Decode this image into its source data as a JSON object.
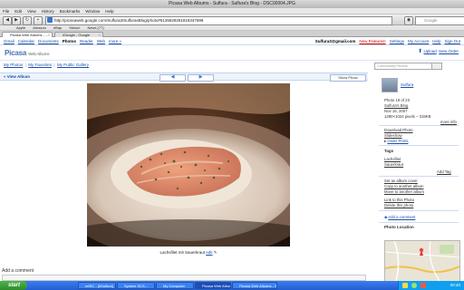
{
  "window": {
    "title": "Picasa Web Albums - Sulfura - Sulfura's Blog - DSC00004.JPG"
  },
  "menu": [
    "File",
    "Edit",
    "View",
    "History",
    "Bookmarks",
    "Window",
    "Help"
  ],
  "browser": {
    "url": "http://picasaweb.google.com/Sulfura3/SulfurasBlog/photo#5135828291818347698",
    "search_placeholder": "Google"
  },
  "bookmarks": [
    "Apple",
    "Amazon",
    "eBay",
    "Yahoo!",
    "News (77)"
  ],
  "tabs": [
    {
      "label": "Picasa Web Albums - ..."
    },
    {
      "label": "iGoogle - Google Search"
    }
  ],
  "gbar": {
    "left": [
      "Gmail",
      "Calendar",
      "Documents",
      "Photos",
      "Reader",
      "Web",
      "more »"
    ],
    "current": "Photos",
    "right": [
      "Sulfura3@gmail.com",
      "New Features!",
      "Settings",
      "My Account",
      "Help",
      "Sign Out"
    ]
  },
  "header": {
    "logo": "Picasa",
    "logo_sub": "Web Albums",
    "upload": "Upload",
    "new_order": "New Order"
  },
  "subnav": {
    "links": [
      "My Photos",
      "My Favorites",
      "My Public Gallery"
    ],
    "search_placeholder": "Community Photos"
  },
  "photobar": {
    "view_album": "« View Album",
    "prev": "◀",
    "next": "▶",
    "show_photo": "Show Photo"
  },
  "photo": {
    "caption": "Lachsfilet mit Sauerkraut",
    "edit": "edit"
  },
  "sidebar": {
    "user": "Sulfura",
    "info": [
      "Photo 19 of 23",
      "Sulfura's Blog",
      "Nov 15, 2007",
      "1280×1024 pixels – 318KB"
    ],
    "more_info": "more info",
    "actions": [
      "Download Photo",
      "Slideshow"
    ],
    "order_prints": "Order Prints",
    "tags_heading": "Tags",
    "tags": [
      "Lachsfilet",
      "Sauerkraut"
    ],
    "add_tag": "Add Tag",
    "album_actions": [
      "Set as album cover",
      "Copy to another album",
      "Move to another album",
      "Link to this Photo",
      "Delete this photo"
    ],
    "add_comment": "Add a comment",
    "location_heading": "Photo Location"
  },
  "comments": {
    "heading": "Add a comment"
  },
  "taskbar": {
    "start": "start",
    "items": [
      "mIRC - [#Sulfura]",
      "System SCS...",
      "My Computer",
      "Picasa Web Albums",
      "Picasa Web Albums - S..."
    ],
    "clock": "00:40"
  }
}
